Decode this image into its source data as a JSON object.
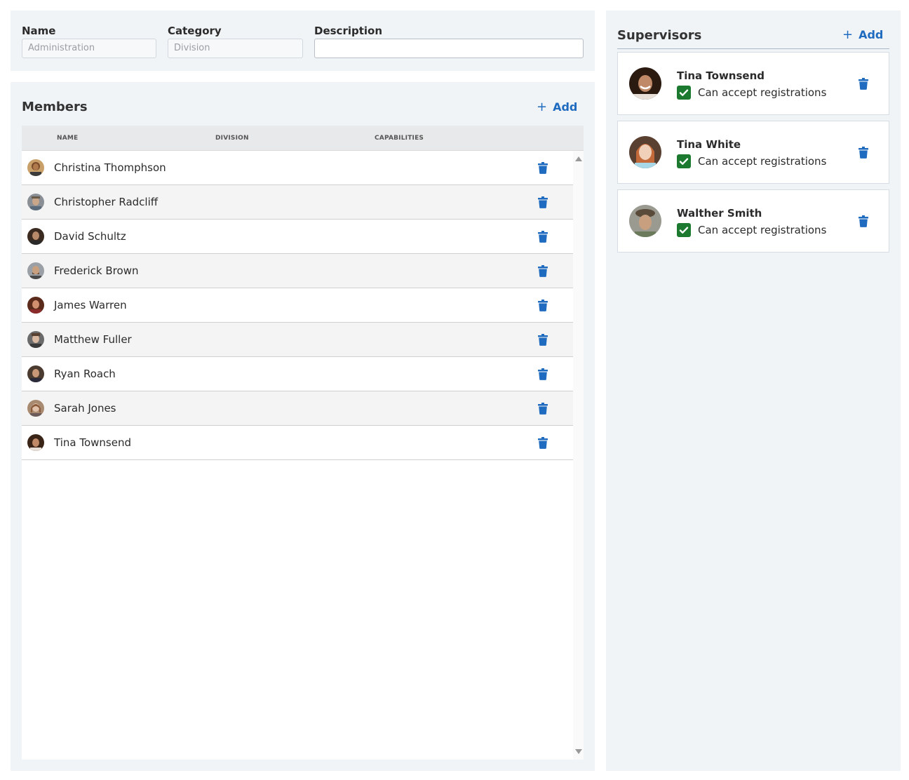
{
  "form": {
    "name": {
      "label": "Name",
      "placeholder": "Administration"
    },
    "category": {
      "label": "Category",
      "placeholder": "Division"
    },
    "description": {
      "label": "Description",
      "value": ""
    }
  },
  "members": {
    "title": "Members",
    "add_label": "Add",
    "columns": [
      "NAME",
      "DIVISION",
      "CAPABILITIES"
    ],
    "rows": [
      {
        "name": "Christina Thomphson"
      },
      {
        "name": "Christopher Radcliff"
      },
      {
        "name": "David Schultz"
      },
      {
        "name": "Frederick Brown"
      },
      {
        "name": "James Warren"
      },
      {
        "name": "Matthew Fuller"
      },
      {
        "name": "Ryan Roach"
      },
      {
        "name": "Sarah Jones"
      },
      {
        "name": "Tina Townsend"
      }
    ]
  },
  "supervisors": {
    "title": "Supervisors",
    "add_label": "Add",
    "items": [
      {
        "name": "Tina Townsend",
        "capability": "Can accept registrations",
        "checked": true
      },
      {
        "name": "Tina White",
        "capability": "Can accept registrations",
        "checked": true
      },
      {
        "name": "Walther Smith",
        "capability": "Can accept registrations",
        "checked": true
      }
    ]
  },
  "colors": {
    "accent": "#1f6bbf",
    "checkbox": "#1b7a2f",
    "panel_bg": "#f1f4f7"
  },
  "icons": {
    "add": "plus-icon",
    "delete": "trash-icon",
    "check": "check-icon",
    "scroll_up": "arrow-up-icon",
    "scroll_down": "arrow-down-icon"
  }
}
